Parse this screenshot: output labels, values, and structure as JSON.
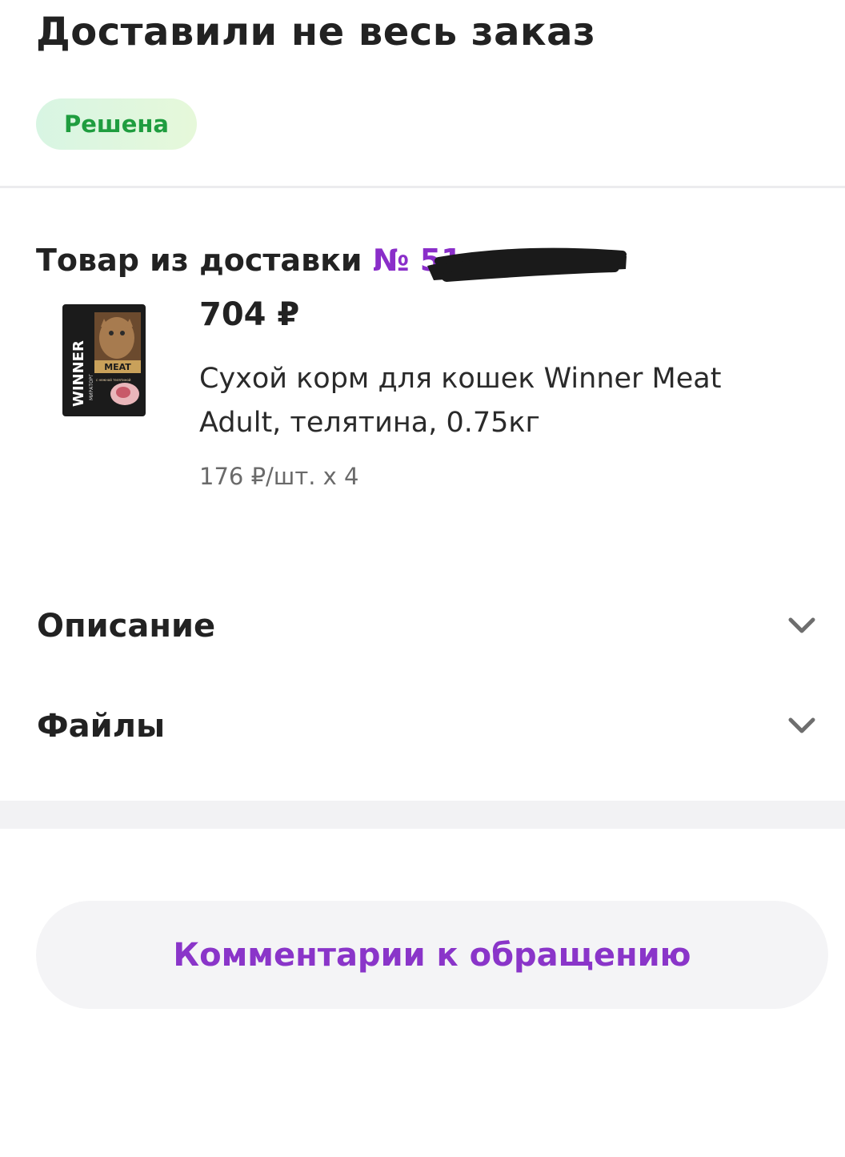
{
  "header": {
    "title": "Доставили не весь заказ",
    "status": "Решена"
  },
  "delivery": {
    "heading": "Товар из доставки",
    "order_number_prefix": "№ 51"
  },
  "product": {
    "image_brand": "WINNER",
    "image_sub_brand": "МИРАТОРГ",
    "image_label": "MEAT",
    "image_flavor": "с нежной телятиной",
    "price": "704 ₽",
    "name": "Сухой корм для кошек Winner Meat Adult, телятина, 0.75кг",
    "unit_price": "176 ₽/шт. x 4"
  },
  "accordions": [
    {
      "label": "Описание",
      "icon": "chevron-down-icon"
    },
    {
      "label": "Файлы",
      "icon": "chevron-down-icon"
    }
  ],
  "actions": {
    "comments_label": "Комментарии к обращению"
  },
  "colors": {
    "accent": "#8a35c9",
    "status_text": "#1f9d3f",
    "status_bg": "#dff6e1"
  }
}
